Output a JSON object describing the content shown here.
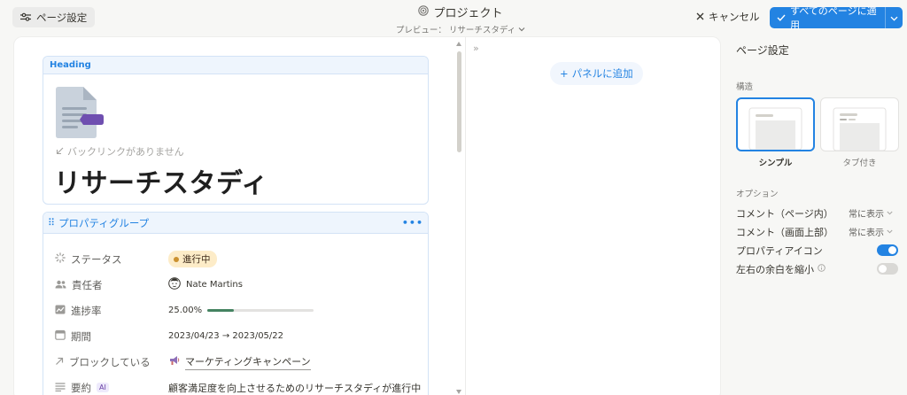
{
  "topbar": {
    "page_settings_label": "ページ設定",
    "title": "プロジェクト",
    "preview_label": "プレビュー： リサーチスタディ",
    "cancel_label": "キャンセル",
    "apply_label": "すべてのページに適用"
  },
  "page": {
    "heading_block_label": "Heading",
    "backlink_text": "バックリンクがありません",
    "title": "リサーチスタディ",
    "property_group_label": "プロパティグループ",
    "properties": [
      {
        "label": "ステータス",
        "icon": "status-icon",
        "value": "進行中"
      },
      {
        "label": "責任者",
        "icon": "people-icon",
        "value": "Nate Martins"
      },
      {
        "label": "進捗率",
        "icon": "chart-icon",
        "value": "25.00%",
        "progress": 0.25
      },
      {
        "label": "期間",
        "icon": "calendar-icon",
        "value": "2023/04/23 → 2023/05/22"
      },
      {
        "label": "ブロックしている",
        "icon": "arrow-up-right-icon",
        "value": "マーケティングキャンペーン"
      },
      {
        "label": "要約",
        "icon": "text-icon",
        "value": "顧客満足度を向上させるためのリサーチスタディが進行中",
        "badge": "AI"
      }
    ],
    "add_panel_label": "パネルに追加"
  },
  "settings": {
    "title": "ページ設定",
    "structure_label": "構造",
    "layouts": [
      {
        "name": "シンプル",
        "selected": true
      },
      {
        "name": "タブ付き",
        "selected": false
      }
    ],
    "options_label": "オプション",
    "options": [
      {
        "label": "コメント（ページ内）",
        "value": "常に表示"
      },
      {
        "label": "コメント（画面上部）",
        "value": "常に表示"
      },
      {
        "label": "プロパティアイコン",
        "toggle": true
      },
      {
        "label": "左右の余白を縮小",
        "toggle": false
      }
    ]
  },
  "colors": {
    "accent": "#2383e2",
    "status_bg": "#fdecc8",
    "progress": "#448361"
  }
}
